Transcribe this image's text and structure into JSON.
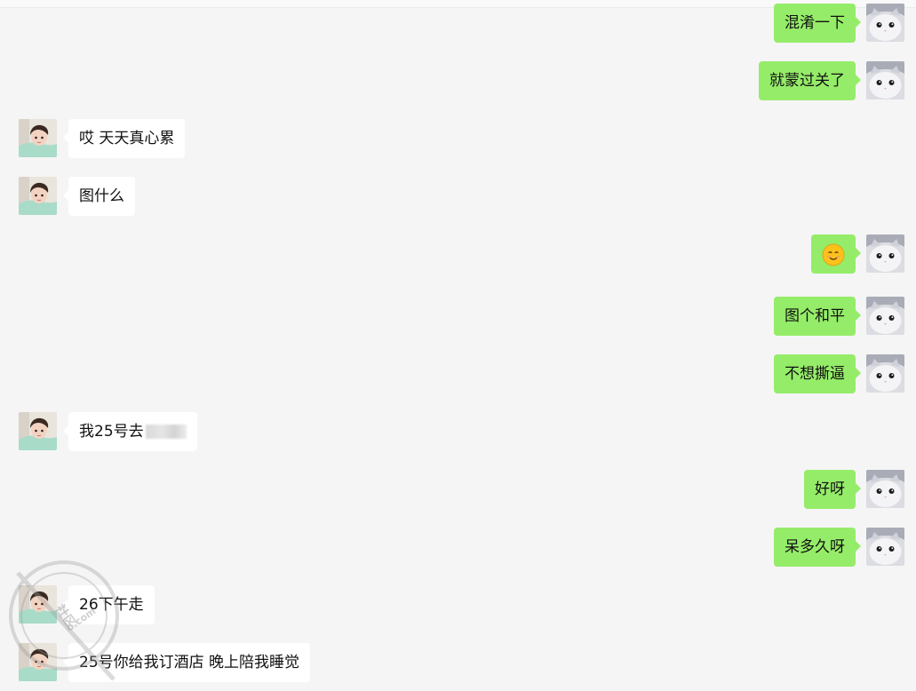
{
  "messages": [
    {
      "side": "right",
      "text": "混淆一下"
    },
    {
      "side": "right",
      "text": "就蒙过关了"
    },
    {
      "side": "left",
      "text": "哎 天天真心累"
    },
    {
      "side": "left",
      "text": "图什么"
    },
    {
      "side": "right",
      "emoji": "smiling-face-emoji"
    },
    {
      "side": "right",
      "text": "图个和平"
    },
    {
      "side": "right",
      "text": "不想撕逼"
    },
    {
      "side": "left",
      "text": "我25号去",
      "blurred": true
    },
    {
      "side": "right",
      "text": "好呀"
    },
    {
      "side": "right",
      "text": "呆多久呀"
    },
    {
      "side": "left",
      "text": "26下午走"
    },
    {
      "side": "left",
      "text": "25号你给我订酒店 晚上陪我睡觉"
    }
  ],
  "watermark": {
    "text": "社区",
    "url_text": "o.com"
  },
  "colors": {
    "sent_bubble": "#95ec69",
    "received_bubble": "#ffffff",
    "background": "#f5f5f5"
  },
  "avatars": {
    "self": "cat-avatar",
    "contact": "child-avatar"
  }
}
